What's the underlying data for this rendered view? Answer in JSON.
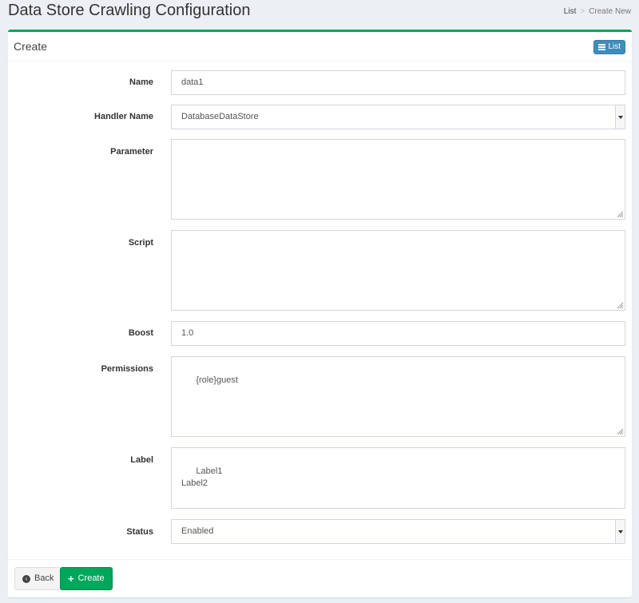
{
  "page": {
    "title": "Data Store Crawling Configuration",
    "breadcrumb": {
      "list": "List",
      "separator": ">",
      "current": "Create New"
    }
  },
  "box": {
    "title": "Create",
    "list_button": "List"
  },
  "form": {
    "name": {
      "label": "Name",
      "value": "data1"
    },
    "handler_name": {
      "label": "Handler Name",
      "value": "DatabaseDataStore"
    },
    "parameter": {
      "label": "Parameter",
      "value": ""
    },
    "script": {
      "label": "Script",
      "value": ""
    },
    "boost": {
      "label": "Boost",
      "value": "1.0"
    },
    "permissions": {
      "label": "Permissions",
      "value": "{role}guest"
    },
    "label": {
      "label": "Label",
      "value": "Label1\nLabel2"
    },
    "status": {
      "label": "Status",
      "value": "Enabled"
    }
  },
  "footer": {
    "back_label": "Back",
    "create_label": "Create"
  },
  "colors": {
    "accent_green": "#00a65a",
    "accent_blue": "#3c8dbc",
    "background": "#ecf0f5"
  }
}
